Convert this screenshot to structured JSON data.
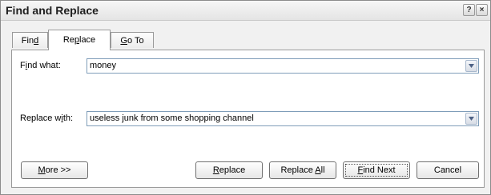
{
  "window": {
    "title": "Find and Replace",
    "help_glyph": "?",
    "close_glyph": "×"
  },
  "tabs": [
    {
      "label_pre": "Fin",
      "label_u": "d",
      "label_post": ""
    },
    {
      "label_pre": "Re",
      "label_u": "p",
      "label_post": "lace"
    },
    {
      "label_pre": "",
      "label_u": "G",
      "label_post": "o To"
    }
  ],
  "find": {
    "label_pre": "F",
    "label_u": "i",
    "label_post": "nd what:",
    "value": "money"
  },
  "replace": {
    "label_pre": "Replace w",
    "label_u": "i",
    "label_post": "th:",
    "value": "useless junk from some shopping channel"
  },
  "buttons": {
    "more": {
      "pre": "",
      "u": "M",
      "post": "ore >>"
    },
    "replace": {
      "pre": "",
      "u": "R",
      "post": "eplace"
    },
    "replace_all": {
      "pre": "Replace ",
      "u": "A",
      "post": "ll"
    },
    "find_next": {
      "pre": "",
      "u": "F",
      "post": "ind Next"
    },
    "cancel": {
      "pre": "Cancel",
      "u": "",
      "post": ""
    }
  }
}
